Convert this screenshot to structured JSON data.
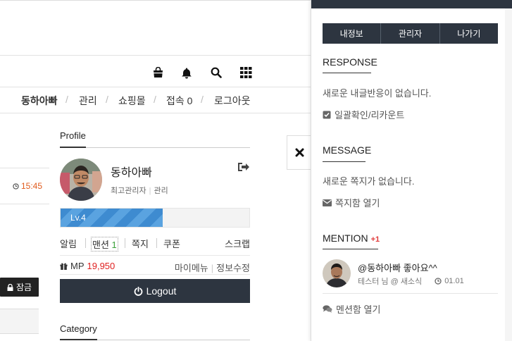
{
  "header": {
    "icons": [
      "shopping-bag-icon",
      "bell-icon",
      "search-icon",
      "grid-icon"
    ]
  },
  "userbar": {
    "nick": "동하아빠",
    "admin": "관리",
    "shop": "쇼핑몰",
    "connect": "접속 0",
    "logout": "로그아웃"
  },
  "feed": {
    "time": "15:45",
    "lock_label": "잠금"
  },
  "profile": {
    "section_title": "Profile",
    "nickname": "동하아빠",
    "role": "최고관리자",
    "role_link": "관리",
    "level_label": "Lv.4",
    "level_progress": 0.54,
    "menu": {
      "alarm": "알림",
      "mention": "맨션",
      "mention_count": "1",
      "memo": "쪽지",
      "coupon": "쿠폰",
      "scrap": "스크랩"
    },
    "mp_label": "MP",
    "mp_value": "19,950",
    "my_menu": "마이메뉴",
    "edit_info": "정보수정",
    "logout_label": "Logout"
  },
  "category": {
    "title": "Category"
  },
  "panel": {
    "tabs": [
      "내정보",
      "관리자",
      "나가기"
    ],
    "response": {
      "title": "RESPONSE",
      "empty": "새로운 내글반응이 없습니다.",
      "action": "일괄확인/리카운트"
    },
    "message": {
      "title": "MESSAGE",
      "empty": "새로운 쪽지가 없습니다.",
      "action": "쪽지함 열기"
    },
    "mention": {
      "title": "MENTION",
      "badge": "+1",
      "item_text": "@동하아빠 좋아요^^",
      "item_author": "테스터 님 @ 새소식",
      "item_date": "01.01",
      "action": "멘션함 열기"
    }
  },
  "colors": {
    "dark": "#2d3540",
    "accent_red": "#e02020",
    "accent_orange": "#e05a1c",
    "level_blue": "#3e8bd0"
  }
}
